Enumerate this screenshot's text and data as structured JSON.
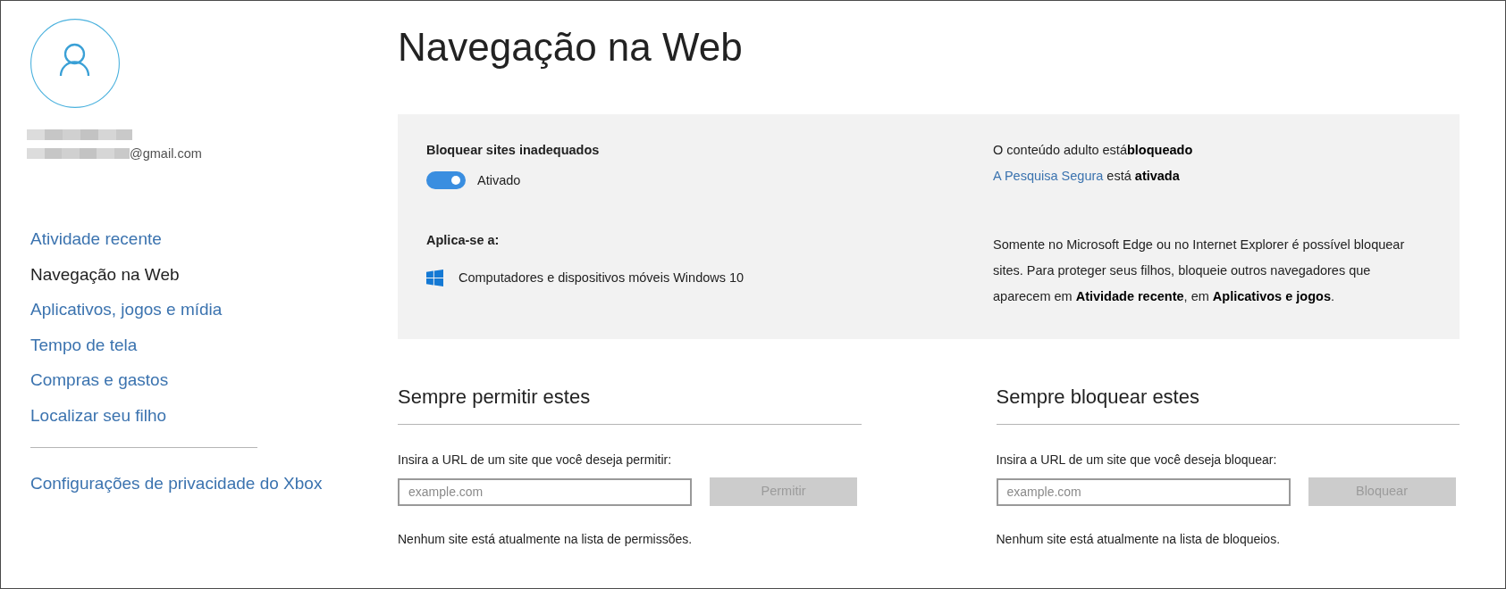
{
  "profile": {
    "name_redacted": true,
    "email": "@gmail.com",
    "email_redacted": true
  },
  "sidebar": {
    "items": [
      {
        "label": "Atividade recente",
        "selected": false
      },
      {
        "label": "Navegação na Web",
        "selected": true
      },
      {
        "label": "Aplicativos, jogos e mídia",
        "selected": false
      },
      {
        "label": "Tempo de tela",
        "selected": false
      },
      {
        "label": "Compras e gastos",
        "selected": false
      },
      {
        "label": "Localizar seu filho",
        "selected": false
      }
    ],
    "footer_items": [
      {
        "label": "Configurações de privacidade do Xbox",
        "selected": false
      }
    ]
  },
  "title": "Navegação na Web",
  "filter_panel": {
    "label": "Bloquear sites inadequados",
    "toggle": {
      "on": true,
      "label": "Ativado"
    },
    "applies_to": {
      "label": "Aplica-se a:",
      "devices": [
        {
          "label": "Computadores e dispositivos móveis Windows 10"
        }
      ]
    },
    "status": [
      {
        "text": "O conteúdo adulto está**bloqueado**"
      },
      {
        "link": "A Pesquisa Segura",
        "text": "está **ativada**"
      }
    ],
    "note": "Somente no Microsoft Edge ou no Internet Explorer é possível bloquear sites. Para proteger seus filhos, bloqueie outros navegadores que aparecem em **Atividade recente**, em **Aplicativos e jogos**."
  },
  "lists": [
    {
      "title": "Sempre permitir estes",
      "prompt": "Insira a URL de um site que você deseja permitir:",
      "input": {
        "placeholder": "example.com"
      },
      "button": {
        "label": "Permitir",
        "disabled": true
      },
      "empty_message": "Nenhum site está atualmente na lista de permissões."
    },
    {
      "title": "Sempre bloquear estes",
      "prompt": "Insira a URL de um site que você deseja bloquear:",
      "input": {
        "placeholder": "example.com"
      },
      "button": {
        "label": "Bloquear",
        "disabled": true
      },
      "empty_message": "Nenhum site está atualmente na lista de bloqueios."
    }
  ]
}
